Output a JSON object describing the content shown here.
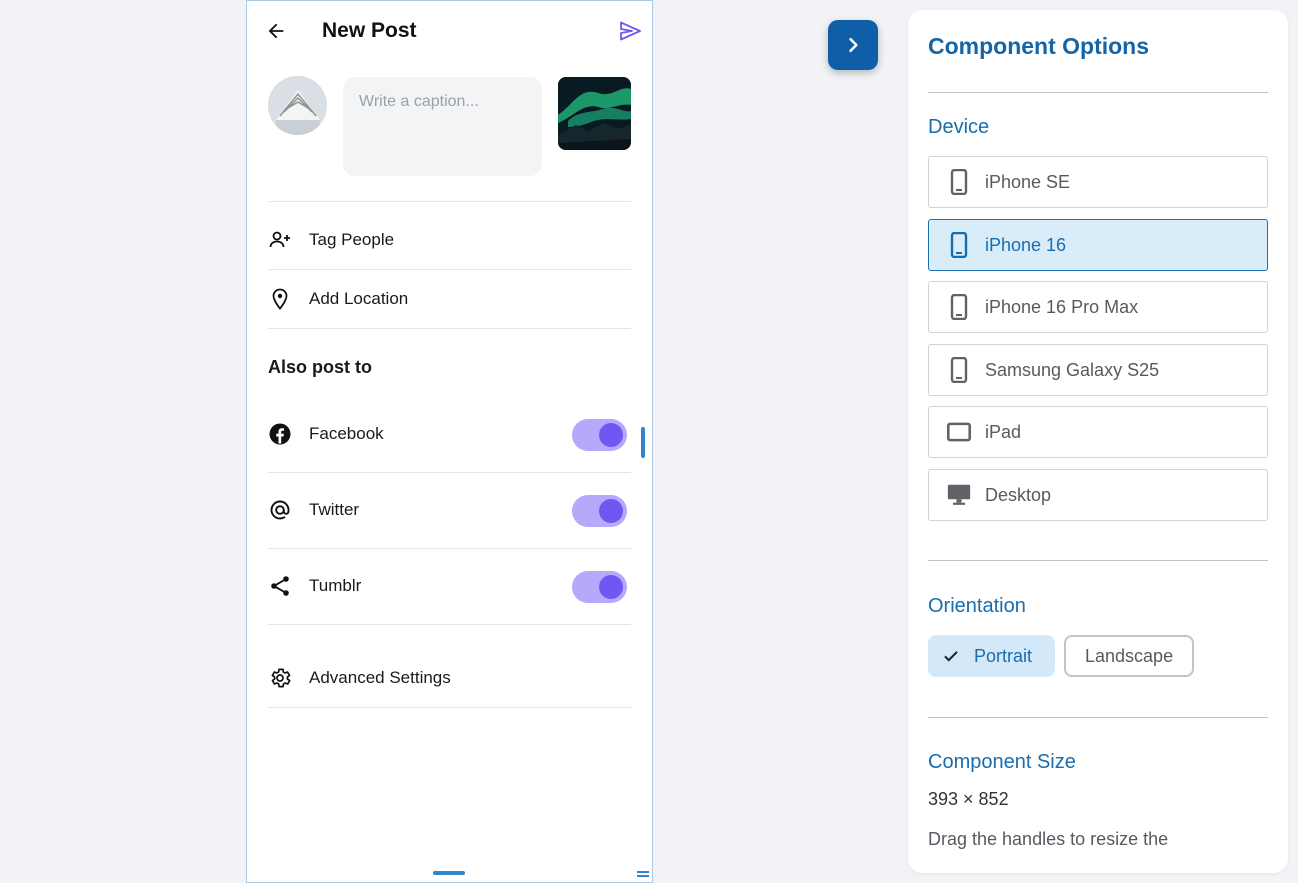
{
  "phone": {
    "title": "New Post",
    "caption_placeholder": "Write a caption...",
    "rows": [
      {
        "label": "Tag People",
        "icon": "person-add-icon"
      },
      {
        "label": "Add Location",
        "icon": "location-pin-icon"
      }
    ],
    "also_post_to": "Also post to",
    "share_targets": [
      {
        "label": "Facebook",
        "icon": "facebook-icon",
        "enabled": true
      },
      {
        "label": "Twitter",
        "icon": "at-sign-icon",
        "enabled": true
      },
      {
        "label": "Tumblr",
        "icon": "share-icon",
        "enabled": true
      }
    ],
    "advanced": {
      "label": "Advanced Settings",
      "icon": "gear-icon"
    },
    "colors": {
      "accent": "#7057f2",
      "toggle_track": "#b6a9fb"
    }
  },
  "panel": {
    "title": "Component Options",
    "device_section": "Device",
    "devices": [
      {
        "label": "iPhone SE",
        "icon": "phone-icon",
        "selected": false
      },
      {
        "label": "iPhone 16",
        "icon": "phone-icon",
        "selected": true
      },
      {
        "label": "iPhone 16 Pro Max",
        "icon": "phone-icon",
        "selected": false
      },
      {
        "label": "Samsung Galaxy S25",
        "icon": "phone-icon",
        "selected": false
      },
      {
        "label": "iPad",
        "icon": "tablet-icon",
        "selected": false
      },
      {
        "label": "Desktop",
        "icon": "desktop-icon",
        "selected": false
      }
    ],
    "orientation_section": "Orientation",
    "orientation": {
      "portrait": "Portrait",
      "landscape": "Landscape",
      "selected": "Portrait"
    },
    "size_section": "Component Size",
    "size_value": "393 × 852",
    "size_help": "Drag the handles to resize the",
    "colors": {
      "brand": "#1565a6",
      "selected_bg": "#d8ecfa"
    }
  }
}
